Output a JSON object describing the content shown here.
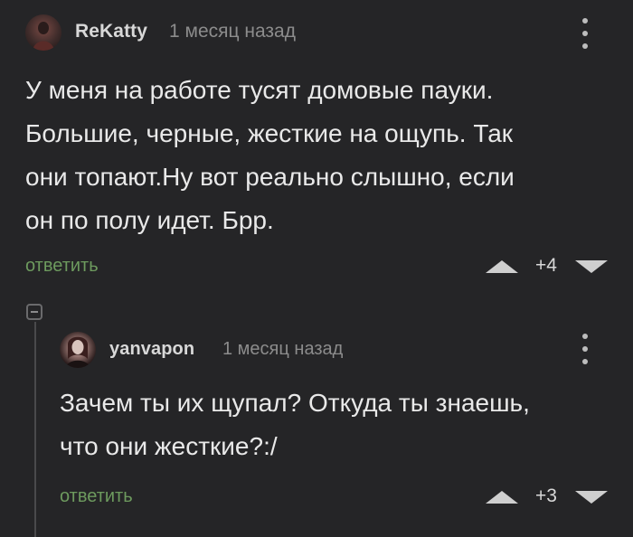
{
  "comments": [
    {
      "author": "ReKatty",
      "time": "1 месяц назад",
      "text": "У меня на работе тусят домовые пауки.\nБольшие, черные, жесткие на ощупь. Так\nони топают.Ну вот реально слышно, если\nон по полу идет. Брр.",
      "reply_label": "ответить",
      "score": "+4"
    },
    {
      "author": "yanvapon",
      "time": "1 месяц назад",
      "text": "Зачем ты их щупал? Откуда ты знаешь,\nчто они жесткие?:/",
      "reply_label": "ответить",
      "score": "+3"
    }
  ],
  "colors": {
    "background": "#252527",
    "reply_link": "#6d9a5e",
    "meta_text": "#8c8c8c"
  },
  "icons": [
    "more-vertical-icon",
    "vote-up-icon",
    "vote-down-icon",
    "collapse-thread-icon"
  ]
}
